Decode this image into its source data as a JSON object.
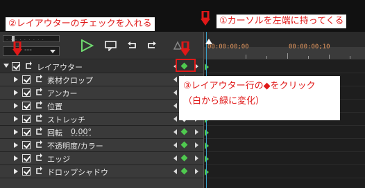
{
  "annotations": {
    "step1": "①カーソルを左端に持ってくる",
    "step2": "②レイアウターのチェックを入れる",
    "step3_line1": "③レイアウター行の◆をクリック",
    "step3_line2": "（白から緑に変化）"
  },
  "toolbar": {
    "dropdown_value": "---",
    "icons": [
      "play-icon",
      "comment-icon",
      "undo-icon",
      "redo-icon",
      "extra-icon"
    ]
  },
  "timeline": {
    "timecode_start": "00:00:00;00",
    "timecode_next": "00:00:00;10"
  },
  "tracks": [
    {
      "label": "レイアウター",
      "expanded": true,
      "keyframe": "green"
    },
    {
      "label": "素材クロップ",
      "expanded": false,
      "keyframe": "none"
    },
    {
      "label": "アンカー",
      "expanded": false,
      "keyframe": "none"
    },
    {
      "label": "位置",
      "expanded": false,
      "keyframe": "none"
    },
    {
      "label": "ストレッチ",
      "expanded": false,
      "keyframe": "none"
    },
    {
      "label": "回転",
      "value": "0.00°",
      "expanded": false,
      "keyframe": "green"
    },
    {
      "label": "不透明度/カラー",
      "expanded": false,
      "keyframe": "green"
    },
    {
      "label": "エッジ",
      "expanded": false,
      "keyframe": "green"
    },
    {
      "label": "ドロップシャドウ",
      "expanded": false,
      "keyframe": "green"
    }
  ],
  "colors": {
    "accent_red": "#e01818",
    "keyframe_green": "#4fc94f",
    "keyframe_white": "#e8e8e8",
    "cursor_blue": "#3aa0c8"
  }
}
